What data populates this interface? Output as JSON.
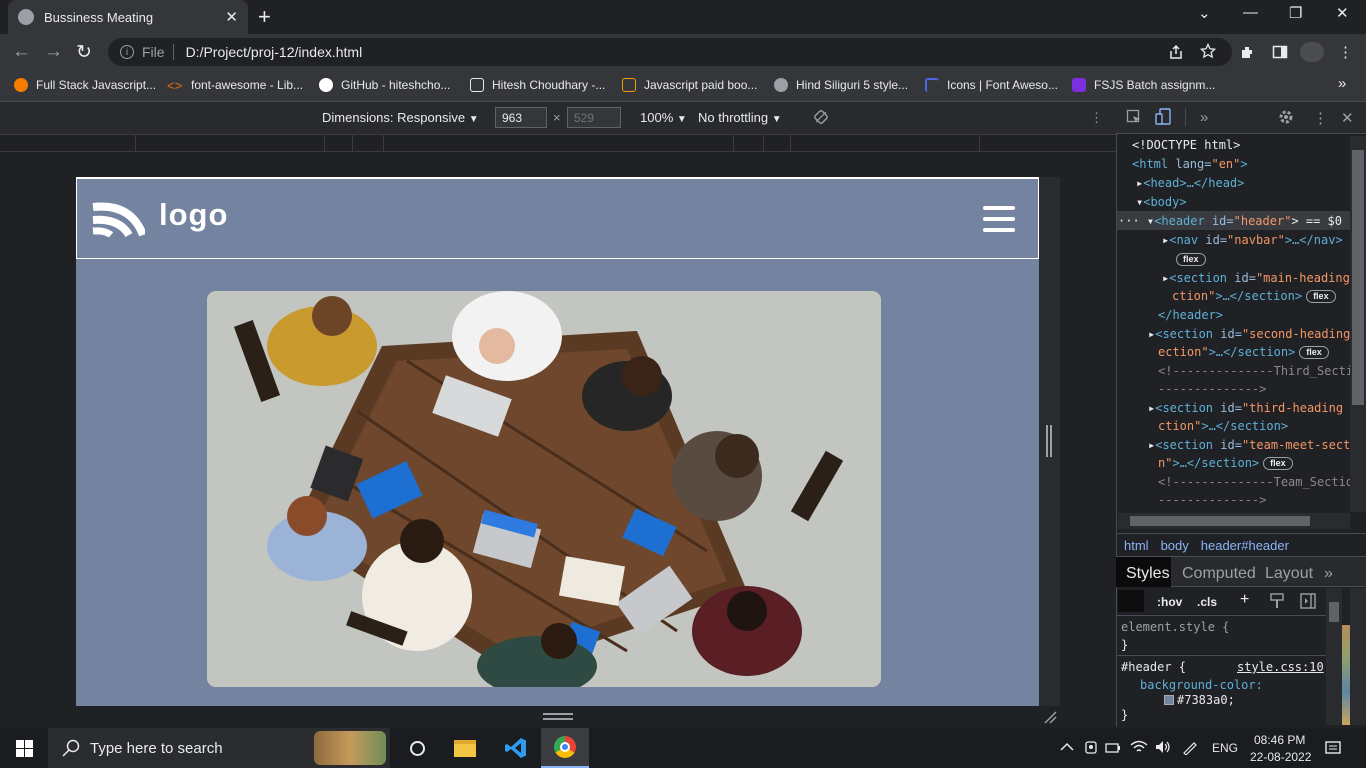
{
  "browser": {
    "tab_title": "Bussiness Meating",
    "tab_close": "✕",
    "new_tab": "+",
    "window_controls": [
      "⌄",
      "—",
      "❐",
      "✕"
    ],
    "nav": {
      "back": "←",
      "forward": "→",
      "reload": "↻"
    },
    "omnibox": {
      "info": "i",
      "scheme_label": "File",
      "url": "D:/Project/proj-12/index.html"
    },
    "toolbar_icons": [
      "share-icon",
      "star-icon",
      "extensions-icon",
      "sidepanel-icon",
      "profile-icon",
      "menu-icon"
    ],
    "bookmarks": [
      {
        "label": "Full Stack Javascript...",
        "color": "#f57c00"
      },
      {
        "label": "font-awesome - Lib...",
        "color": "#e8710a"
      },
      {
        "label": "GitHub - hiteshcho...",
        "color": "#ffffff"
      },
      {
        "label": "Hitesh Choudhary -...",
        "color": "#e8eaed"
      },
      {
        "label": "Javascript paid boo...",
        "color": "#f29900"
      },
      {
        "label": "Hind Siliguri 5 style...",
        "color": "#9aa0a6"
      },
      {
        "label": "Icons | Font Aweso...",
        "color": "#4a66e8"
      },
      {
        "label": "FSJS Batch assignm...",
        "color": "#7b2fe0"
      }
    ],
    "bookmarks_more": "»"
  },
  "device_toolbar": {
    "dimensions": "Dimensions: Responsive",
    "width": "963",
    "times": "×",
    "height": "529",
    "zoom": "100%",
    "throttle": "No throttling",
    "caret": "▼",
    "more": "⋮"
  },
  "page": {
    "logo_text": "logo",
    "header_bg": "#7383a0",
    "hero_alt": "team meeting"
  },
  "devtools": {
    "more_tabs": "»",
    "close": "✕",
    "kebab": "⋮",
    "elements": {
      "l1": "<!DOCTYPE html>",
      "l2_tag": "<html",
      "l2_attr": " lang=",
      "l2_val": "\"en\"",
      "l2_end": ">",
      "l3": "<head>…</head>",
      "l4": "<body>",
      "l5_tag": "<header",
      "l5_attr": " id=",
      "l5_val": "\"header\"",
      "l5_end": "> == $0",
      "l6_tag": "<nav",
      "l6_attr": " id=",
      "l6_val": "\"navbar\"",
      "l6_end": ">…</nav>",
      "badge": "flex",
      "l8_tag": "<section",
      "l8_attr": " id=",
      "l8_val": "\"main-heading",
      "l9_val": "ction\"",
      "l9_end": ">…</section>",
      "l10": "</header>",
      "l11_val": "\"second-heading",
      "l12_val": "ection\"",
      "l13": "<!--------------Third_Secti",
      "l14": "-------------->",
      "l15_val": "\"third-heading",
      "l16_val": "ction\"",
      "l17_val": "\"team-meet-sect",
      "l18_val": "n\"",
      "l19": "<!--------------Team_Section",
      "l20": "-------------->"
    },
    "breadcrumbs": [
      "html",
      "body",
      "header#header"
    ],
    "style_tabs": [
      "Styles",
      "Computed",
      "Layout"
    ],
    "style_tabs_more": "»",
    "filter_buttons": [
      ":hov",
      ".cls",
      "+"
    ],
    "css": {
      "element_style": "element.style {",
      "close": "}",
      "selector": "#header {",
      "source": "style.css:10",
      "prop": "background-color:",
      "value": "#7383a0;",
      "swatch": "#7383a0"
    }
  },
  "taskbar": {
    "search_placeholder": "Type here to search",
    "time": "08:46 PM",
    "date": "22-08-2022",
    "lang": "ENG"
  }
}
